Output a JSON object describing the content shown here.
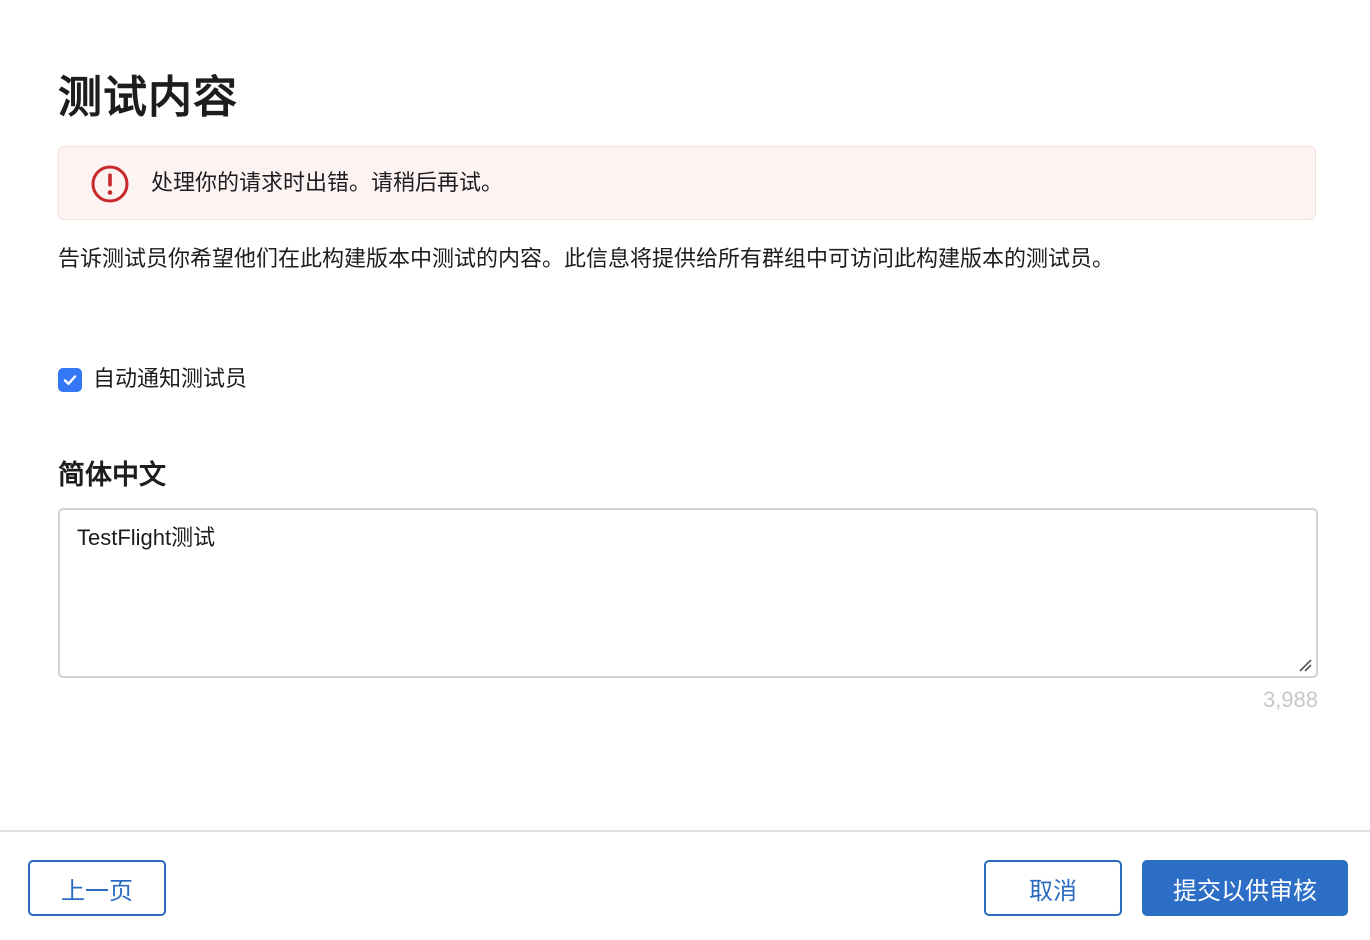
{
  "header": {
    "title": "测试内容"
  },
  "error": {
    "icon": "exclamation-circle-icon",
    "message": "处理你的请求时出错。请稍后再试。",
    "color": "#c6282b"
  },
  "description": "告诉测试员你希望他们在此构建版本中测试的内容。此信息将提供给所有群组中可访问此构建版本的测试员。",
  "notify": {
    "label": "自动通知测试员",
    "checked": true
  },
  "locale": {
    "label": "简体中文",
    "text": "TestFlight测试",
    "remaining": "3,988"
  },
  "footer": {
    "prev_label": "上一页",
    "cancel_label": "取消",
    "submit_label": "提交以供审核"
  },
  "colors": {
    "accent": "#2c6ec6",
    "checkbox": "#3478f6",
    "error_bg": "#fdf3f2"
  }
}
